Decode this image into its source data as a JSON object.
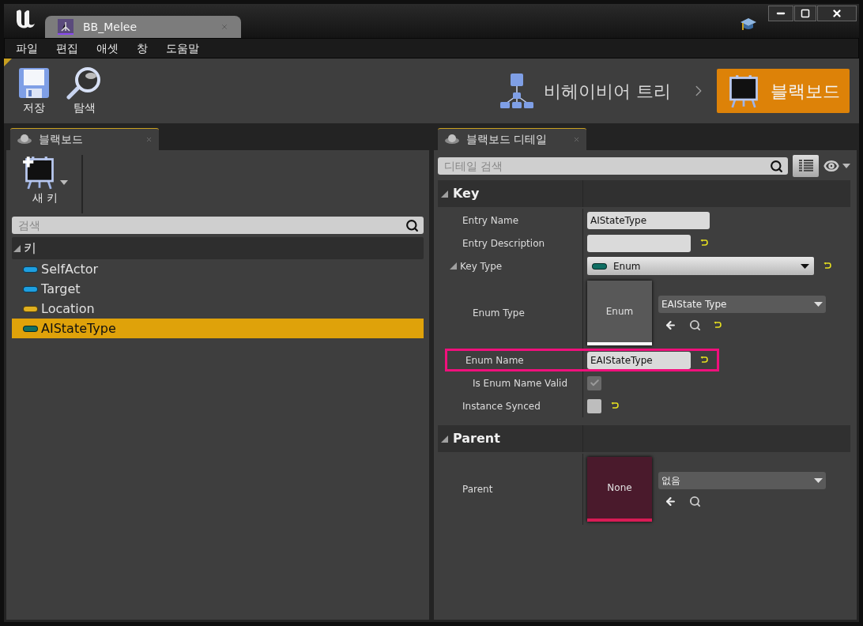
{
  "window": {
    "tab_title": "BB_Melee"
  },
  "menu": [
    "파일",
    "편집",
    "애셋",
    "창",
    "도움말"
  ],
  "toolbar": [
    {
      "label": "저장",
      "kind": "save"
    },
    {
      "label": "탐색",
      "kind": "browse"
    }
  ],
  "breadcrumb": [
    {
      "label": "비헤이비어 트리",
      "kind": "tree",
      "selected": false
    },
    {
      "label": "블랙보드",
      "kind": "board",
      "selected": true
    }
  ],
  "blackboard_panel": {
    "tab": "블랙보드",
    "new_key": "새 키",
    "search": {
      "placeholder": "검색"
    },
    "category": {
      "label": "키",
      "expanded": true
    },
    "keys": [
      {
        "name": "SelfActor",
        "color": "#1e9fe0",
        "selected": false
      },
      {
        "name": "Target",
        "color": "#1e9fe0",
        "selected": false
      },
      {
        "name": "Location",
        "color": "#e0b020",
        "selected": false
      },
      {
        "name": "AIStateType",
        "color": "#0f6e63",
        "selected": true
      }
    ]
  },
  "details_panel": {
    "tab": "블랙보드 디테일",
    "search": {
      "placeholder": "디테일 검색"
    },
    "sections": [
      {
        "title": "Key",
        "expanded": true,
        "rows": [
          {
            "label": "Entry Name",
            "kind": "text",
            "value": "AIStateType",
            "reset": false,
            "highlighted": false
          },
          {
            "label": "Entry Description",
            "kind": "text",
            "reset": true,
            "highlighted": false
          },
          {
            "label": "Key Type",
            "kind": "type",
            "value": "Enum",
            "color": "#0f6e63",
            "reset": true,
            "expanded": true,
            "children": [
              {
                "label": "Enum Type",
                "kind": "asset",
                "thumbnail": "Enum",
                "value": "EAIState Type",
                "color": "#ffffff",
                "reset": true
              },
              {
                "label": "Enum Name",
                "kind": "text",
                "value": "EAIStateType",
                "reset": true,
                "highlighted": true
              },
              {
                "label": "Is Enum Name Valid",
                "kind": "checkbox",
                "checked": true,
                "disabled": true,
                "reset": false
              }
            ]
          },
          {
            "label": "Instance Synced",
            "kind": "checkbox",
            "checked": false,
            "disabled": false,
            "reset": true
          }
        ]
      },
      {
        "title": "Parent",
        "expanded": true,
        "rows": [
          {
            "label": "Parent",
            "kind": "asset",
            "thumbnail": "None",
            "value": "없음",
            "color": "#d81b55",
            "reset": false
          }
        ]
      }
    ]
  }
}
